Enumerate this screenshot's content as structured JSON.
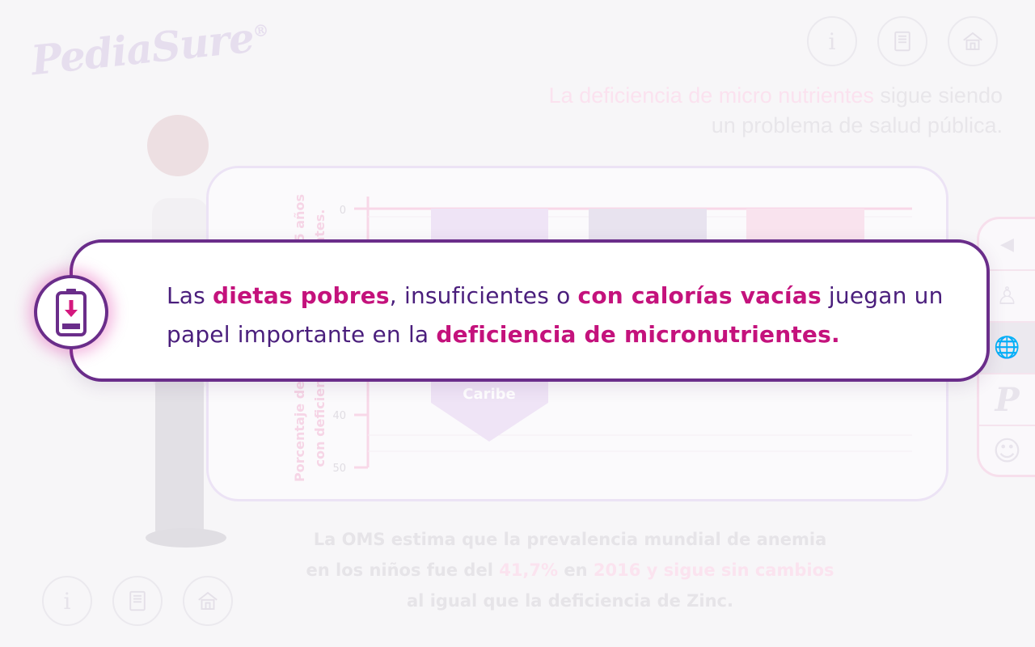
{
  "brand": {
    "logo_text": "PediaSure",
    "logo_mark": "®"
  },
  "top_nav": [
    {
      "icon": "info-icon",
      "glyph": "i"
    },
    {
      "icon": "book-icon",
      "glyph": ""
    },
    {
      "icon": "home-icon",
      "glyph": ""
    }
  ],
  "headline": {
    "highlight": "La deficiencia de micro nutrientes",
    "rest_line1": " sigue siendo",
    "line2": "un problema de salud pública."
  },
  "chart": {
    "y_axis_label_line1": "Porcentaje de niños menores de 5 años",
    "y_axis_label_line2": "con deficiencia de micronutrientes.",
    "y_ticks": [
      "0",
      "40",
      "50"
    ],
    "visible_category": "Caribe"
  },
  "footer": {
    "line1": "La OMS estima que la prevalencia mundial de anemia",
    "line2_a": "en los niños fue del ",
    "line2_pct": "41,7%",
    "line2_b": " en ",
    "line2_year": "2016 y sigue sin cambios",
    "line3": "al igual que la deficiencia de Zinc."
  },
  "popup": {
    "t1": "Las ",
    "b1": "dietas pobres",
    "t2": ", insuficientes o ",
    "b2": "con calorías vacías",
    "t3": " juegan un papel importante en la ",
    "b3": "deficiencia de micronutrientes."
  },
  "side_menu": [
    {
      "icon": "back-arrow-icon",
      "glyph": "◀"
    },
    {
      "icon": "child-figure-icon",
      "glyph": "♙"
    },
    {
      "icon": "globe-icon",
      "glyph": "🌐"
    },
    {
      "icon": "pediasure-p-icon",
      "glyph": "P"
    },
    {
      "icon": "smiley-icon",
      "glyph": "☺"
    }
  ],
  "colors": {
    "popup_border": "#6a2d8a",
    "popup_text": "#4a1e7c",
    "popup_highlight": "#c4127c",
    "icon_glow": "#dc28a0"
  }
}
